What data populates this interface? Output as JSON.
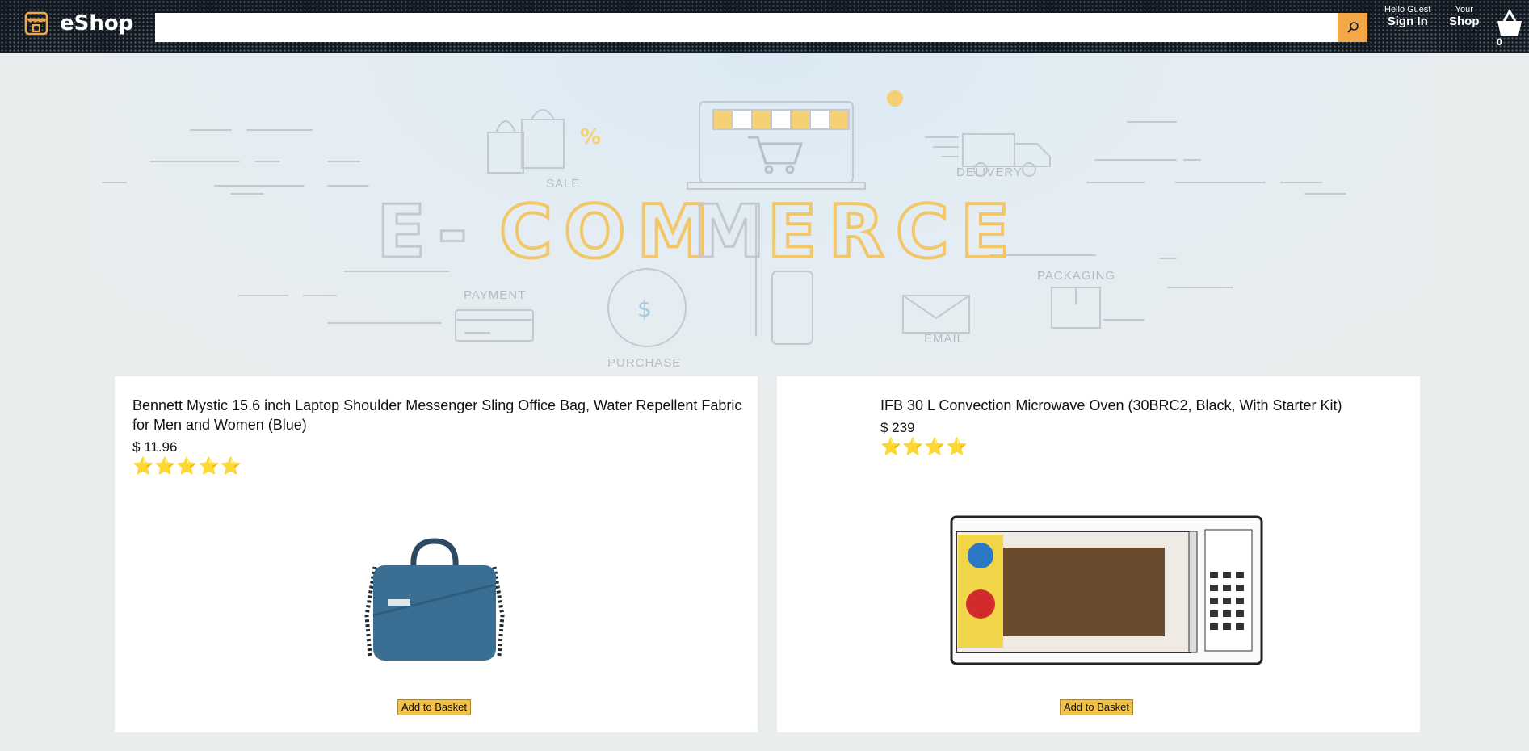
{
  "header": {
    "logo_text": "eShop",
    "search_placeholder": "",
    "options": [
      {
        "line1": "Hello Guest",
        "line2": "Sign In"
      },
      {
        "line1": "Your",
        "line2": "Shop"
      }
    ],
    "basket_count": "0"
  },
  "banner": {
    "headline_plain": "E-",
    "headline_accent_1": "COM",
    "headline_plain_2": "M",
    "headline_accent_2": "ERCE",
    "labels": [
      "SALE",
      "DELIVERY",
      "PAYMENT",
      "PACKAGING",
      "PURCHASE",
      "EMAIL"
    ],
    "icons": [
      "shopping-bag-icon",
      "percent-icon",
      "storefront-laptop-icon",
      "cart-icon",
      "delivery-truck-icon",
      "location-pin-icon",
      "credit-card-icon",
      "dollar-cycle-icon",
      "phone-hand-icon",
      "envelope-icon",
      "box-hand-icon"
    ]
  },
  "products": [
    {
      "title": "Bennett Mystic 15.6 inch Laptop Shoulder Messenger Sling Office Bag, Water Repellent Fabric for Men and Women (Blue)",
      "price": "$ 11.96",
      "rating": "⭐⭐⭐⭐⭐",
      "rating_value": 5,
      "image_icon": "laptop-bag-image",
      "button_label": "Add to Basket"
    },
    {
      "title": "IFB 30 L Convection Microwave Oven (30BRC2, Black, With Starter Kit)",
      "price": "$ 239",
      "rating": "⭐⭐⭐⭐",
      "rating_value": 4,
      "image_icon": "microwave-oven-image",
      "button_label": "Add to Basket"
    }
  ],
  "colors": {
    "header_bg": "#131921",
    "accent": "#f3a847",
    "page_bg": "#eaeded",
    "button": "#f0c14b"
  }
}
